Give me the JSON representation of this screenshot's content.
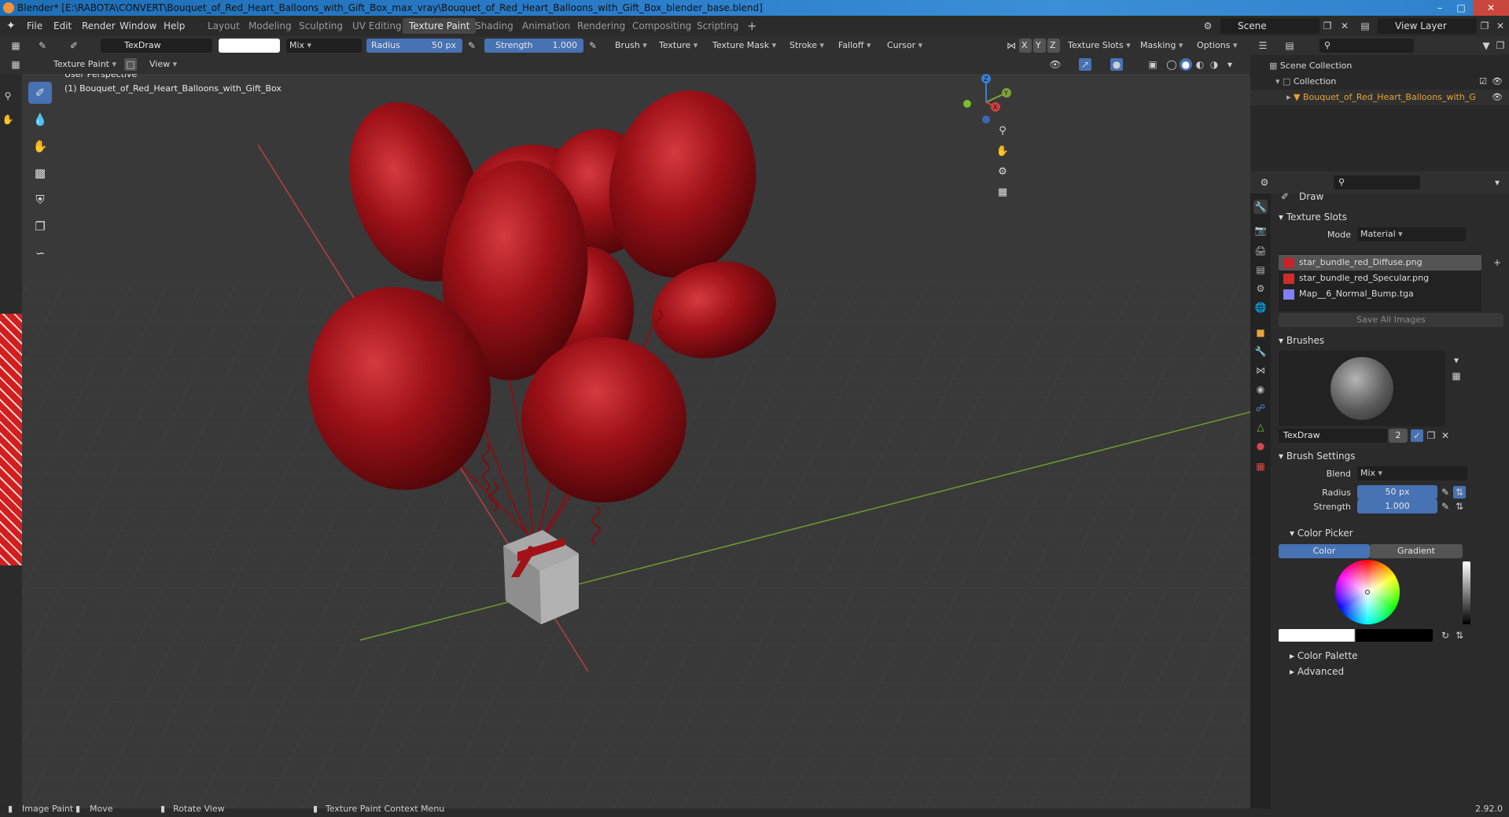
{
  "window": {
    "title": "Blender* [E:\\RABOTA\\CONVERT\\Bouquet_of_Red_Heart_Balloons_with_Gift_Box_max_vray\\Bouquet_of_Red_Heart_Balloons_with_Gift_Box_blender_base.blend]",
    "controls": [
      "–",
      "□",
      "✕"
    ]
  },
  "menu": [
    "File",
    "Edit",
    "Render",
    "Window",
    "Help"
  ],
  "workspaces": [
    {
      "label": "Layout"
    },
    {
      "label": "Modeling"
    },
    {
      "label": "Sculpting"
    },
    {
      "label": "UV Editing"
    },
    {
      "label": "Texture Paint",
      "active": true
    },
    {
      "label": "Shading"
    },
    {
      "label": "Animation"
    },
    {
      "label": "Rendering"
    },
    {
      "label": "Compositing"
    },
    {
      "label": "Scripting"
    }
  ],
  "scene": {
    "name": "Scene",
    "view_layer": "View Layer"
  },
  "tool_header": {
    "brush_name": "TexDraw",
    "blend": "Mix",
    "radius_label": "Radius",
    "radius_value": "50 px",
    "strength_label": "Strength",
    "strength_value": "1.000",
    "menus": [
      "Brush",
      "Texture",
      "Texture Mask",
      "Stroke",
      "Falloff",
      "Cursor"
    ],
    "axes": [
      "X",
      "Y",
      "Z"
    ],
    "right_menus": [
      "Texture Slots",
      "Masking",
      "Options"
    ]
  },
  "mode_header": {
    "mode": "Texture Paint",
    "view": "View"
  },
  "viewport": {
    "perspective": "User Perspective",
    "object_label": "(1) Bouquet_of_Red_Heart_Balloons_with_Gift_Box",
    "gizmo": {
      "x": "X",
      "y": "Y",
      "z": "Z"
    }
  },
  "outliner": {
    "scene_collection": "Scene Collection",
    "collection": "Collection",
    "object": "Bouquet_of_Red_Heart_Balloons_with_G"
  },
  "properties": {
    "tool_name": "Draw",
    "texture_slots": {
      "title": "Texture Slots",
      "mode_label": "Mode",
      "mode_value": "Material",
      "slots": [
        {
          "name": "star_bundle_red_Diffuse.png",
          "color": "#c8232a",
          "selected": true
        },
        {
          "name": "star_bundle_red_Specular.png",
          "color": "#d32a2a",
          "selected": false
        },
        {
          "name": "Map__6_Normal_Bump.tga",
          "color": "#8080ff",
          "selected": false
        }
      ],
      "save_all": "Save All Images"
    },
    "brushes": {
      "title": "Brushes",
      "brush_name": "TexDraw",
      "users": "2"
    },
    "brush_settings": {
      "title": "Brush Settings",
      "blend_label": "Blend",
      "blend_value": "Mix",
      "radius_label": "Radius",
      "radius_value": "50 px",
      "strength_label": "Strength",
      "strength_value": "1.000"
    },
    "color_picker": {
      "title": "Color Picker",
      "tab_color": "Color",
      "tab_gradient": "Gradient"
    },
    "color_palette": "Color Palette",
    "advanced": "Advanced"
  },
  "status_bar": {
    "items": [
      "Image Paint",
      "Move",
      "Rotate View",
      "Texture Paint Context Menu"
    ],
    "version": "2.92.0"
  },
  "colors": {
    "accent": "#4772b3",
    "selection": "#e8a43a",
    "balloon": "#a31218"
  }
}
